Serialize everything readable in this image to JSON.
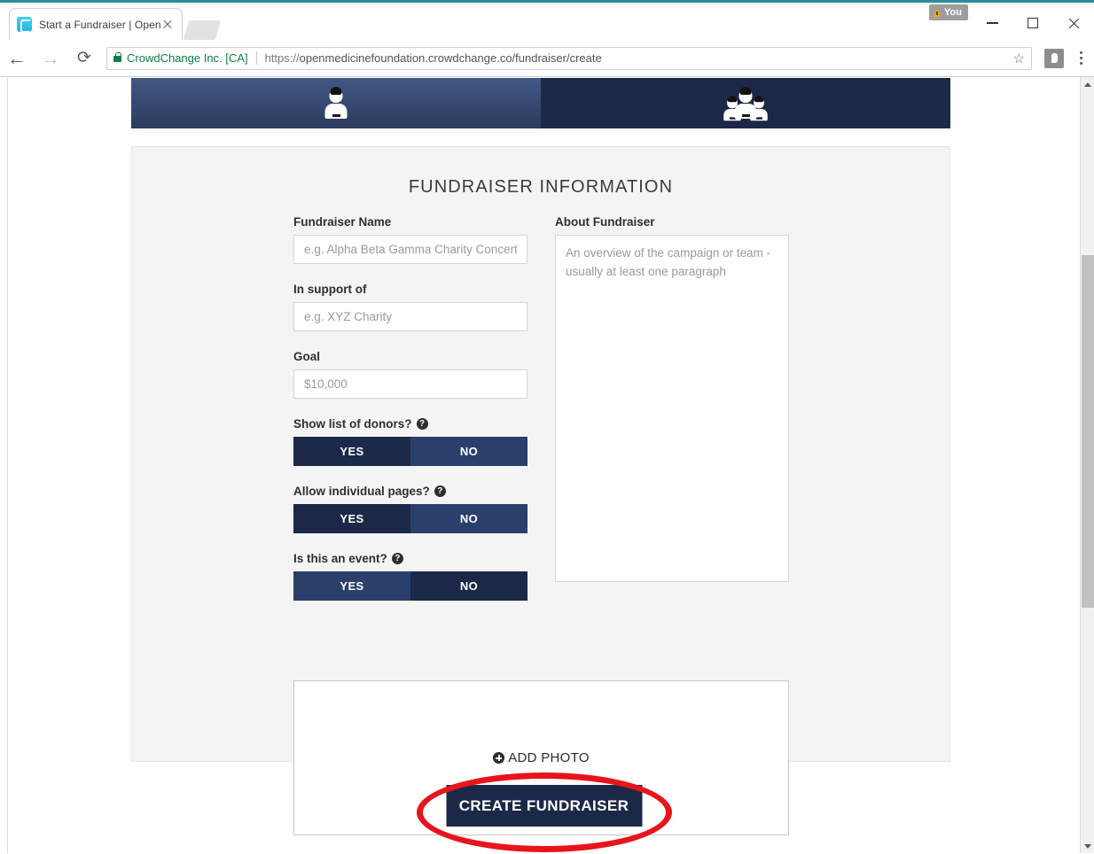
{
  "browser": {
    "tab": {
      "title": "Start a Fundraiser | Open",
      "favicon": "crowdchange-c-icon",
      "close": "×"
    },
    "new_tab_label": "",
    "nav": {
      "back": "←",
      "forward": "→",
      "reload": "⟳"
    },
    "omnibox": {
      "site_identity": "CrowdChange Inc. [CA]",
      "url_scheme": "https://",
      "url_rest": "openmedicinefoundation.crowdchange.co/fundraiser/create",
      "bookmark_star": "☆"
    },
    "profile": {
      "label": "You",
      "warning": "⚠"
    },
    "window_controls": {
      "minimize": "–",
      "maximize": "□",
      "close": "✕"
    }
  },
  "page": {
    "type_tabs": [
      {
        "id": "individual",
        "icon": "single-person-icon",
        "selected": false
      },
      {
        "id": "team",
        "icon": "group-people-icon",
        "selected": true
      }
    ],
    "section_title": "FUNDRAISER INFORMATION",
    "fields": {
      "fundraiser_name": {
        "label": "Fundraiser Name",
        "placeholder": "e.g. Alpha Beta Gamma Charity Concert",
        "value": ""
      },
      "in_support_of": {
        "label": "In support of",
        "placeholder": "e.g. XYZ Charity",
        "value": ""
      },
      "goal": {
        "label": "Goal",
        "placeholder": "$10,000",
        "value": ""
      },
      "about": {
        "label": "About Fundraiser",
        "placeholder": "An overview of the campaign or team - usually at least one paragraph",
        "value": ""
      }
    },
    "toggles": [
      {
        "label": "Show list of donors?",
        "help": "?",
        "yes_label": "YES",
        "no_label": "NO",
        "selected": "YES"
      },
      {
        "label": "Allow individual pages?",
        "help": "?",
        "yes_label": "YES",
        "no_label": "NO",
        "selected": "YES"
      },
      {
        "label": "Is this an event?",
        "help": "?",
        "yes_label": "YES",
        "no_label": "NO",
        "selected": "NO"
      }
    ],
    "photo_upload": {
      "label": "ADD PHOTO",
      "icon": "plus-circle-icon"
    },
    "submit_button": "CREATE FUNDRAISER",
    "annotation": {
      "shape": "red-ellipse",
      "color": "#e8141b"
    }
  },
  "colors": {
    "navy_dark": "#1b2847",
    "navy_light": "#2b3f6b",
    "panel_bg": "#f4f4f4",
    "annotation_red": "#e8141b",
    "secure_green": "#0c8043",
    "favicon_cyan": "#1fb8e0"
  }
}
